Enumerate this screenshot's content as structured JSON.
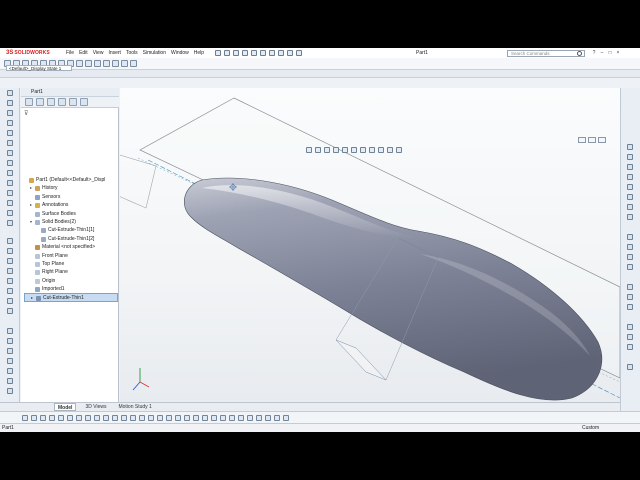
{
  "app": {
    "logo_mark": "3S",
    "logo_text": "SOLIDWORKS",
    "document_title": "Part1",
    "search_placeholder": "Search Commands"
  },
  "menu": [
    "File",
    "Edit",
    "View",
    "Insert",
    "Tools",
    "Simulation",
    "Window",
    "Help"
  ],
  "window_controls": {
    "minimize": "–",
    "restore": "□",
    "close": "×",
    "help": "?"
  },
  "config_selector": "<Default>_Display State 1",
  "feature_manager": {
    "part_header": "Part1",
    "tree": [
      {
        "label": "Part1  (Default<<Default>_Displ",
        "indent": 0,
        "toggle": "",
        "icon": "part-icon",
        "color": "#d4a84a"
      },
      {
        "label": "History",
        "indent": 1,
        "toggle": "▸",
        "icon": "history-icon",
        "color": "#c9a35b"
      },
      {
        "label": "Sensors",
        "indent": 1,
        "toggle": "",
        "icon": "sensors-icon",
        "color": "#8aa5c8"
      },
      {
        "label": "Annotations",
        "indent": 1,
        "toggle": "▸",
        "icon": "annotations-icon",
        "color": "#d4b04a"
      },
      {
        "label": "Surface Bodies",
        "indent": 1,
        "toggle": "",
        "icon": "surface-bodies-icon",
        "color": "#a4b6cf"
      },
      {
        "label": "Solid Bodies(2)",
        "indent": 1,
        "toggle": "▾",
        "icon": "solid-bodies-icon",
        "color": "#a4b6cf"
      },
      {
        "label": "Cut-Extrude-Thin1[1]",
        "indent": 2,
        "toggle": "",
        "icon": "solid-body-icon",
        "color": "#9aaac0"
      },
      {
        "label": "Cut-Extrude-Thin1[2]",
        "indent": 2,
        "toggle": "",
        "icon": "solid-body-icon",
        "color": "#9aaac0"
      },
      {
        "label": "Material <not specified>",
        "indent": 1,
        "toggle": "",
        "icon": "material-icon",
        "color": "#c48f4e"
      },
      {
        "label": "Front Plane",
        "indent": 1,
        "toggle": "",
        "icon": "plane-icon",
        "color": "#b6c6d8"
      },
      {
        "label": "Top Plane",
        "indent": 1,
        "toggle": "",
        "icon": "plane-icon",
        "color": "#b6c6d8"
      },
      {
        "label": "Right Plane",
        "indent": 1,
        "toggle": "",
        "icon": "plane-icon",
        "color": "#b6c6d8"
      },
      {
        "label": "Origin",
        "indent": 1,
        "toggle": "",
        "icon": "origin-icon",
        "color": "#c0c8d2"
      },
      {
        "label": "Imported1",
        "indent": 1,
        "toggle": "",
        "icon": "imported-icon",
        "color": "#8aa7c7"
      },
      {
        "label": "Cut-Extrude-Thin1",
        "indent": 1,
        "toggle": "▸",
        "icon": "cut-extrude-icon",
        "color": "#7b93b3",
        "selected": true
      }
    ]
  },
  "bottom_tabs": [
    "Model",
    "3D Views",
    "Motion Study 1"
  ],
  "status": {
    "left": "Part1",
    "right": "Custom"
  }
}
